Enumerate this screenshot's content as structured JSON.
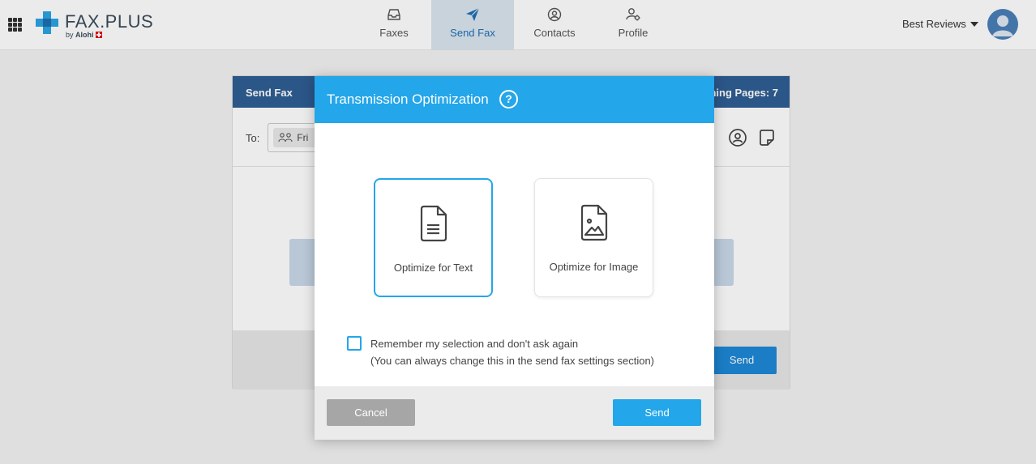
{
  "header": {
    "logo_text": "FAX.PLUS",
    "logo_sub_prefix": "by",
    "logo_sub_brand": "Alohi",
    "account_name": "Best Reviews",
    "nav": [
      {
        "label": "Faxes",
        "icon": "inbox-icon"
      },
      {
        "label": "Send Fax",
        "icon": "paper-plane-icon",
        "active": true
      },
      {
        "label": "Contacts",
        "icon": "contact-circle-icon"
      },
      {
        "label": "Profile",
        "icon": "profile-settings-icon"
      }
    ]
  },
  "send_fax_card": {
    "title": "Send Fax",
    "remaining_pages": "ning Pages: 7",
    "to_label": "To:",
    "recipient_chip": "Fri",
    "send_label": "Send"
  },
  "dialog": {
    "title": "Transmission Optimization",
    "help_glyph": "?",
    "options": [
      {
        "label": "Optimize for Text",
        "icon": "text-document-icon",
        "selected": true
      },
      {
        "label": "Optimize for Image",
        "icon": "image-document-icon",
        "selected": false
      }
    ],
    "remember_line1": "Remember my selection and don't ask again",
    "remember_line2": "(You can always change this in the send fax settings section)",
    "remember_checked": false,
    "cancel_label": "Cancel",
    "send_label": "Send"
  },
  "colors": {
    "dialog_header": "#23a6ea",
    "primary_button": "#23a6ea",
    "cancel_button": "#a6a6a6",
    "card_header": "#2f5e94",
    "nav_active_bg": "#d9e5ef",
    "nav_active_text": "#1f6fb5"
  }
}
